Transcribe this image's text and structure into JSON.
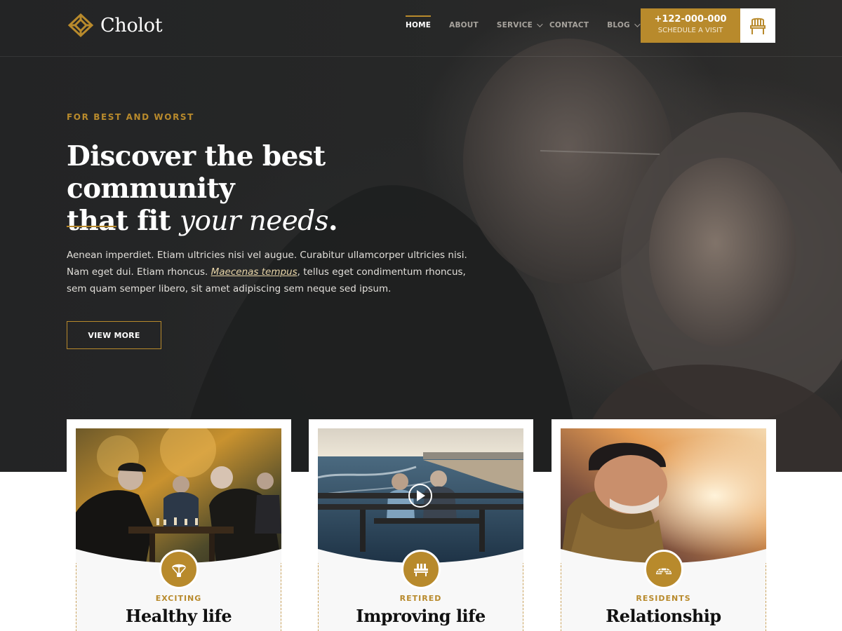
{
  "header": {
    "logo_text": "Cholot",
    "nav": [
      {
        "label": "HOME",
        "active": true,
        "dropdown": false
      },
      {
        "label": "ABOUT",
        "active": false,
        "dropdown": false
      },
      {
        "label": "SERVICE",
        "active": false,
        "dropdown": true
      },
      {
        "label": "CONTACT",
        "active": false,
        "dropdown": false
      },
      {
        "label": "BLOG",
        "active": false,
        "dropdown": true
      }
    ],
    "cta": {
      "phone": "+122-000-000",
      "subtitle": "SCHEDULE A VISIT",
      "icon": "chair-icon"
    }
  },
  "hero": {
    "eyebrow": "FOR BEST AND WORST",
    "headline_line1": "Discover the best community",
    "headline_line2_plain": "that fit ",
    "headline_line2_em": "your needs",
    "headline_line2_end": ".",
    "lead_part1": "Aenean imperdiet. Etiam ultricies nisi vel augue. Curabitur ullamcorper ultricies nisi. Nam eget dui. Etiam rhoncus. ",
    "lead_em": "Maecenas tempus",
    "lead_part2": ", tellus eget condimentum rhoncus, sem quam semper libero, sit amet adipiscing sem neque sed ipsum.",
    "button": "VIEW MORE"
  },
  "cards": [
    {
      "category": "EXCITING",
      "title": "Healthy life",
      "icon": "parachute-icon",
      "photo": "chess-players-photo"
    },
    {
      "category": "RETIRED",
      "title": "Improving life",
      "icon": "bench-icon",
      "photo": "couple-on-bench-photo",
      "has_play": true
    },
    {
      "category": "RESIDENTS",
      "title": "Relationship",
      "icon": "igloo-icon",
      "photo": "elderly-man-sunset-photo"
    }
  ],
  "colors": {
    "accent": "#b88a2c",
    "dark": "#252627",
    "white": "#ffffff"
  }
}
